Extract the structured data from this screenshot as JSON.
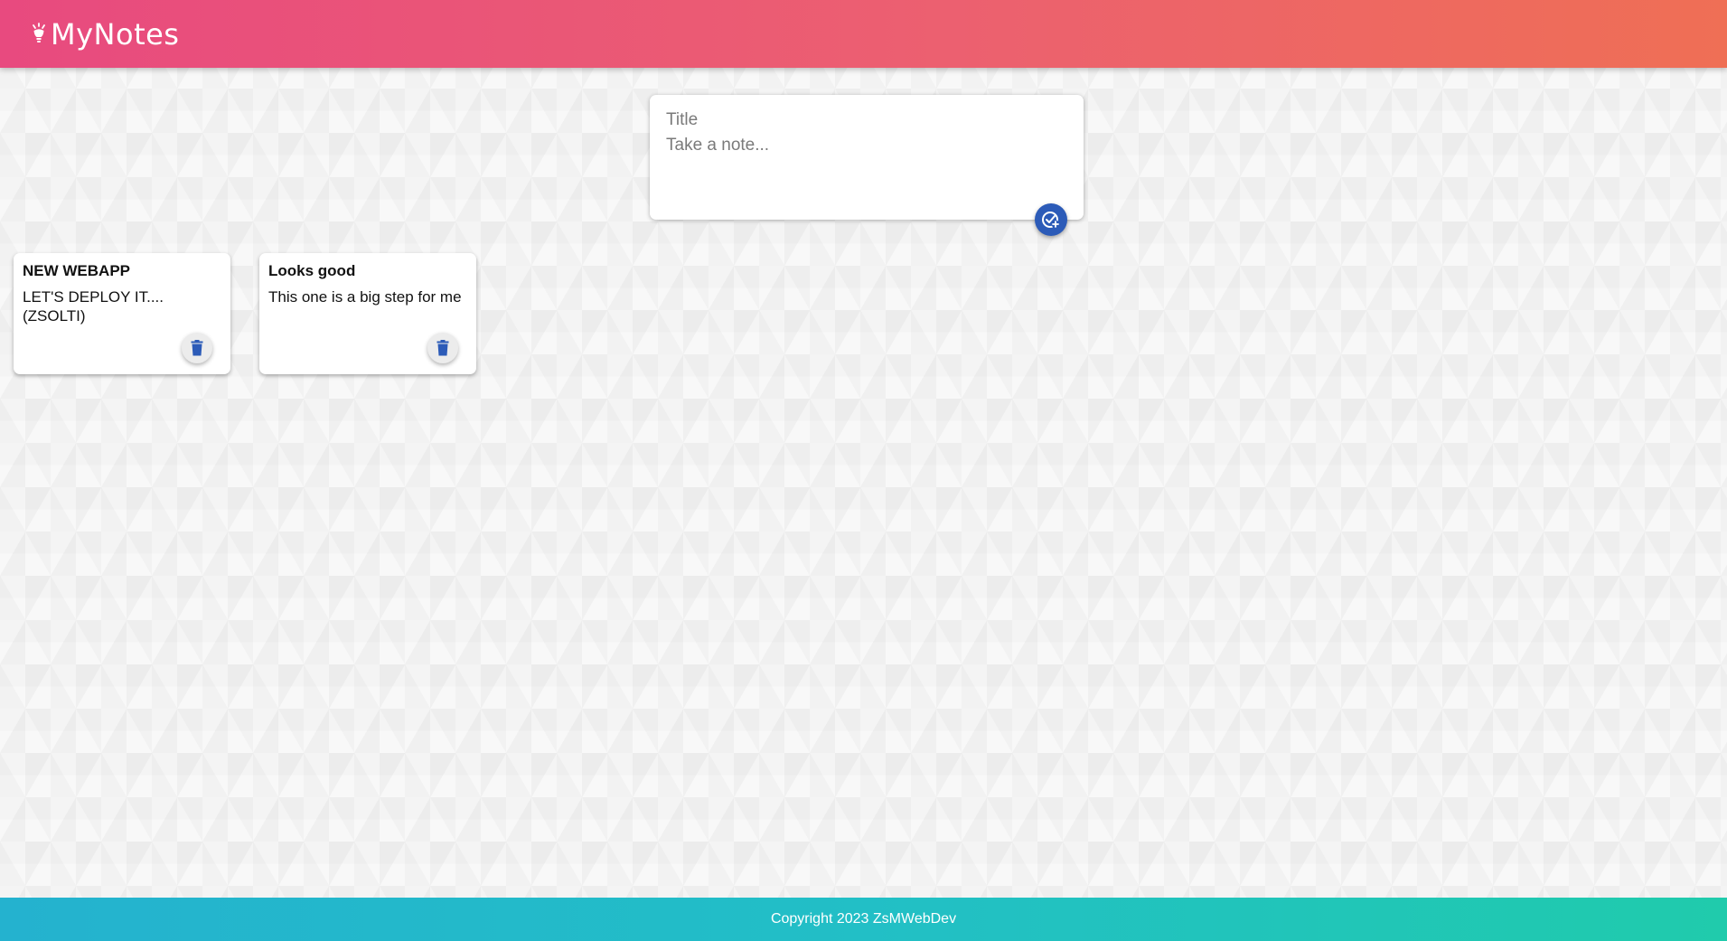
{
  "header": {
    "app_title": "MyNotes",
    "logo_icon": "lightbulb-icon",
    "gradient": [
      "#e84a7f",
      "#ef6f55"
    ]
  },
  "composer": {
    "title_placeholder": "Title",
    "content_placeholder": "Take a note...",
    "add_icon": "add-check-icon",
    "accent": "#2c5bb8"
  },
  "notes": [
    {
      "title": "NEW WEBAPP",
      "content": "LET'S DEPLOY IT.... (ZSOLTI)",
      "delete_icon": "trash-icon"
    },
    {
      "title": "Looks good",
      "content": "This one is a big step for me",
      "delete_icon": "trash-icon"
    }
  ],
  "footer": {
    "copyright": "Copyright 2023 ZsMWebDev",
    "gradient": [
      "#24b2cf",
      "#20cbac"
    ]
  }
}
